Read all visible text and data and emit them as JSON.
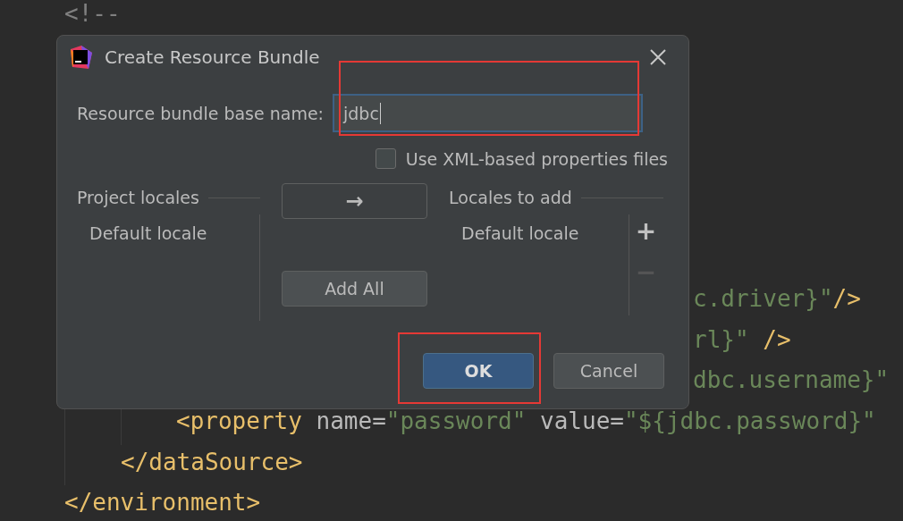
{
  "editor": {
    "lines": [
      [
        {
          "kind": "comment",
          "text": "<!--"
        }
      ],
      [
        {
          "kind": "string",
          "text": "c.driver}\""
        },
        {
          "kind": "tag",
          "text": "/>"
        }
      ],
      [
        {
          "kind": "string",
          "text": "rl}\""
        },
        {
          "kind": "tag",
          "text": " />"
        }
      ],
      [
        {
          "kind": "string",
          "text": "dbc.username}\""
        }
      ],
      [
        {
          "kind": "tag",
          "text": "<property"
        },
        {
          "kind": "attr",
          "text": " name="
        },
        {
          "kind": "string",
          "text": "\"password\""
        },
        {
          "kind": "attr",
          "text": " value="
        },
        {
          "kind": "string",
          "text": "\"${jdbc.password}\""
        }
      ],
      [
        {
          "kind": "tag",
          "text": "</dataSource>"
        }
      ],
      [
        {
          "kind": "tag",
          "text": "</environment>"
        }
      ]
    ]
  },
  "dialog": {
    "title": "Create Resource Bundle",
    "field": {
      "label": "Resource bundle base name:",
      "value": "jdbc"
    },
    "xml_checkbox": {
      "label": "Use XML-based properties files",
      "checked": false
    },
    "project_locales": {
      "title": "Project locales",
      "items": [
        "Default locale"
      ]
    },
    "move_button": {
      "label": "→"
    },
    "add_all_button": {
      "label": "Add All"
    },
    "locales_to_add": {
      "title": "Locales to add",
      "items": [
        "Default locale"
      ]
    },
    "add_button": {
      "label": "+",
      "disabled": false
    },
    "remove_button": {
      "label": "−",
      "disabled": true
    },
    "buttons": [
      {
        "label": "OK",
        "default": true
      },
      {
        "label": "Cancel",
        "default": false
      }
    ]
  }
}
